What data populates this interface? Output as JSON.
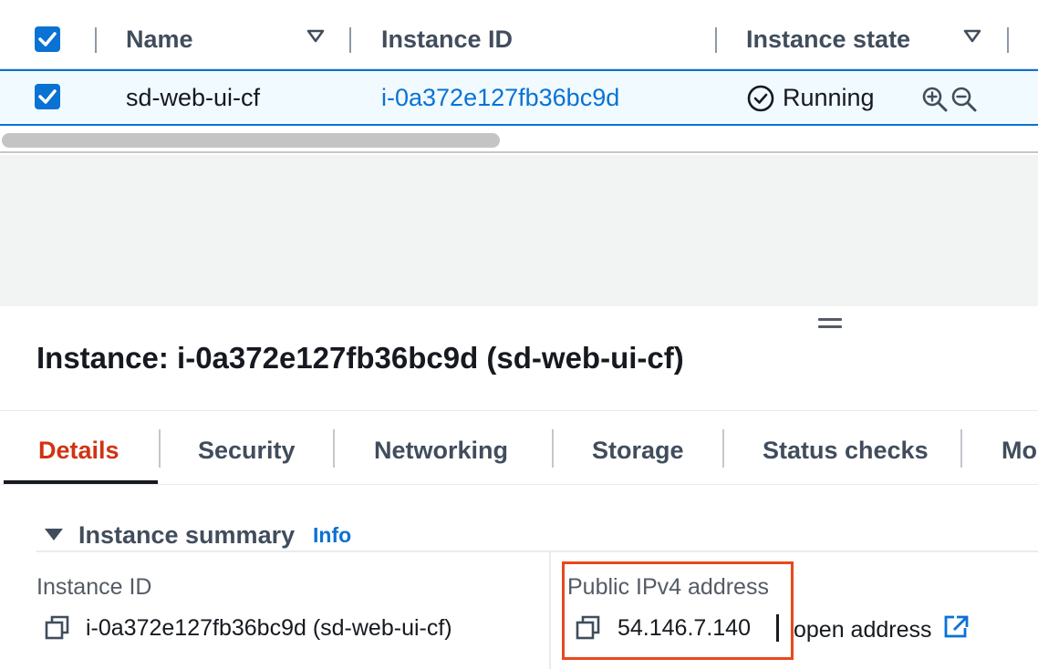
{
  "table": {
    "columns": {
      "name": "Name",
      "instance_id": "Instance ID",
      "instance_state": "Instance state"
    },
    "row": {
      "name": "sd-web-ui-cf",
      "instance_id": "i-0a372e127fb36bc9d",
      "state": "Running"
    }
  },
  "details": {
    "title": "Instance: i-0a372e127fb36bc9d (sd-web-ui-cf)",
    "tabs": [
      {
        "label": "Details"
      },
      {
        "label": "Security"
      },
      {
        "label": "Networking"
      },
      {
        "label": "Storage"
      },
      {
        "label": "Status checks"
      },
      {
        "label": "Mo"
      }
    ],
    "summary": {
      "title": "Instance summary",
      "info_label": "Info",
      "instance_id_label": "Instance ID",
      "instance_id_value": "i-0a372e127fb36bc9d (sd-web-ui-cf)",
      "public_ip_label": "Public IPv4 address",
      "public_ip_value": "54.146.7.140",
      "open_address_label": "open address"
    }
  },
  "colors": {
    "accent": "#0972d3",
    "active_tab": "#d13212",
    "highlight": "#e8481d",
    "selected_row_bg": "#f1faff"
  },
  "icons": {
    "checkbox": "checkmark-icon",
    "sort": "caret-down-icon",
    "status": "check-circle-icon",
    "zoom_in": "zoom-in-icon",
    "zoom_out": "zoom-out-icon",
    "copy": "copy-icon",
    "external": "external-link-icon"
  }
}
